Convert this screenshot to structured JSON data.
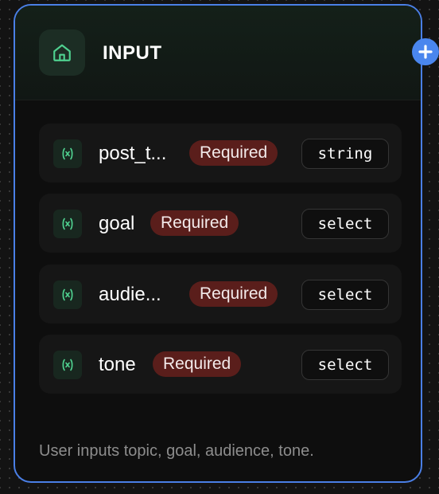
{
  "node": {
    "title": "INPUT",
    "header_icon": "home-icon",
    "description": "User inputs topic, goal, audience, tone.",
    "accent_color": "#4a7fe6",
    "fields": [
      {
        "name": "post_t...",
        "badge": "Required",
        "type": "string",
        "icon": "variable-icon"
      },
      {
        "name": "goal",
        "badge": "Required",
        "type": "select",
        "icon": "variable-icon"
      },
      {
        "name": "audie...",
        "badge": "Required",
        "type": "select",
        "icon": "variable-icon"
      },
      {
        "name": "tone",
        "badge": "Required",
        "type": "select",
        "icon": "variable-icon"
      }
    ]
  },
  "add_handle": {
    "icon": "plus-icon",
    "color": "#4a86ee"
  }
}
